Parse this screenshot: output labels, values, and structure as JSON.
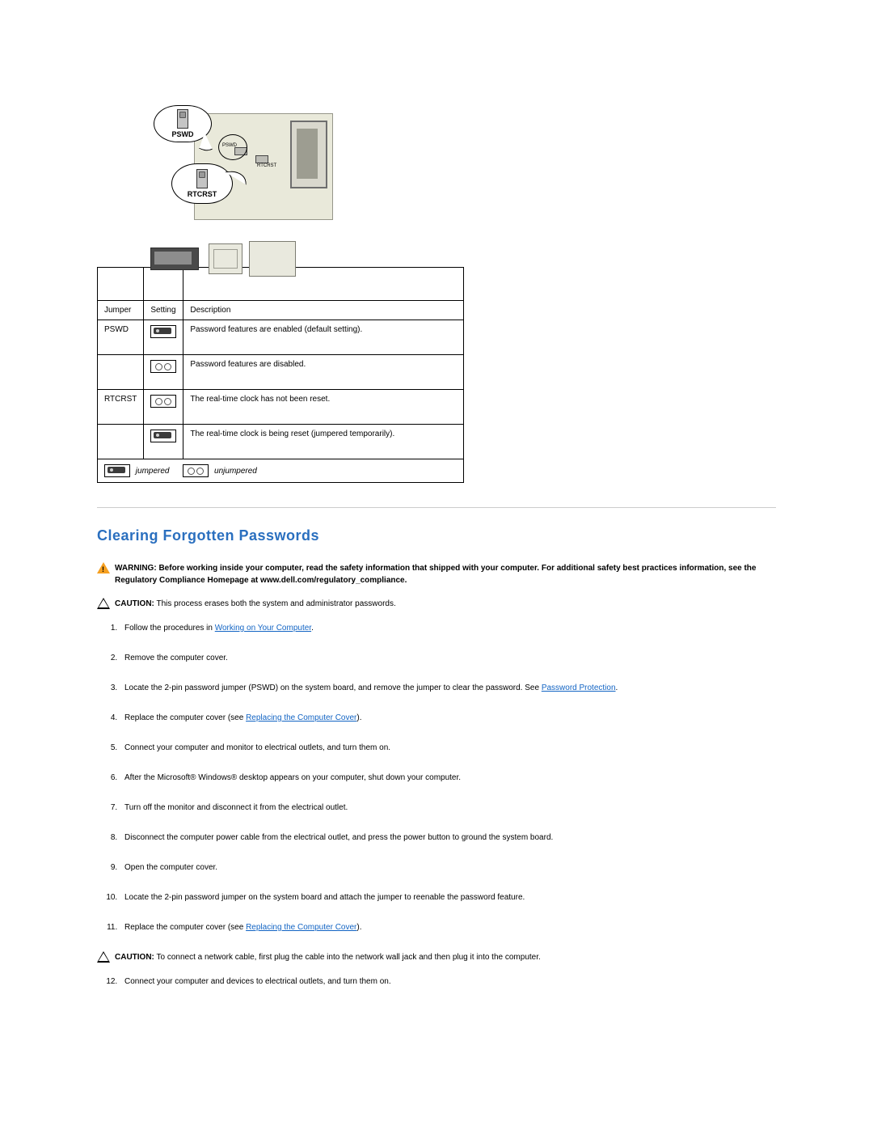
{
  "diagram": {
    "bubble_pswd": "PSWD",
    "bubble_rtcrst": "RTCRST",
    "small_pswd": "PSWD",
    "small_rtcrst": "RTCRST"
  },
  "table": {
    "headers": {
      "jumper": "Jumper",
      "setting": "Setting",
      "description": "Description"
    },
    "rows": [
      {
        "jumper": "PSWD",
        "icon": "jumpered",
        "desc": "Password features are enabled (default setting)."
      },
      {
        "jumper": "",
        "icon": "unjumpered",
        "desc": "Password features are disabled."
      },
      {
        "jumper": "RTCRST",
        "icon": "unjumpered",
        "desc": "The real-time clock has not been reset."
      },
      {
        "jumper": "",
        "icon": "jumpered",
        "desc": "The real-time clock is being reset (jumpered temporarily)."
      }
    ],
    "legend": {
      "jumpered": "jumpered",
      "unjumpered": "unjumpered"
    }
  },
  "section_title": "Clearing Forgotten Passwords",
  "warning": {
    "label": "WARNING:",
    "text": "Before working inside your computer, read the safety information that shipped with your computer. For additional safety best practices information, see the Regulatory Compliance Homepage at www.dell.com/regulatory_compliance."
  },
  "caution1": {
    "label": "CAUTION:",
    "text": "This process erases both the system and administrator passwords."
  },
  "steps1": [
    {
      "pre": "Follow the procedures in ",
      "link": "Working on Your Computer",
      "post": "."
    },
    {
      "pre": "Remove the computer cover."
    },
    {
      "pre": "Locate the 2-pin password jumper (PSWD) on the system board, and remove the jumper to clear the password. See ",
      "link": "Password Protection",
      "post": "."
    },
    {
      "pre": "Replace the computer cover (see ",
      "link": "Replacing the Computer Cover",
      "post": ")."
    },
    {
      "pre": "Connect your computer and monitor to electrical outlets, and turn them on."
    },
    {
      "pre": "After the Microsoft® Windows® desktop appears on your computer, shut down your computer."
    },
    {
      "pre": "Turn off the monitor and disconnect it from the electrical outlet."
    },
    {
      "pre": "Disconnect the computer power cable from the electrical outlet, and press the power button to ground the system board."
    },
    {
      "pre": "Open the computer cover."
    },
    {
      "pre": "Locate the 2-pin password jumper on the system board and attach the jumper to reenable the password feature."
    },
    {
      "pre": "Replace the computer cover (see ",
      "link": "Replacing the Computer Cover",
      "post": ")."
    }
  ],
  "caution2": {
    "label": "CAUTION:",
    "text": "To connect a network cable, first plug the cable into the network wall jack and then plug it into the computer."
  },
  "steps2_start": 12,
  "steps2": [
    {
      "pre": "Connect your computer and devices to electrical outlets, and turn them on."
    }
  ]
}
